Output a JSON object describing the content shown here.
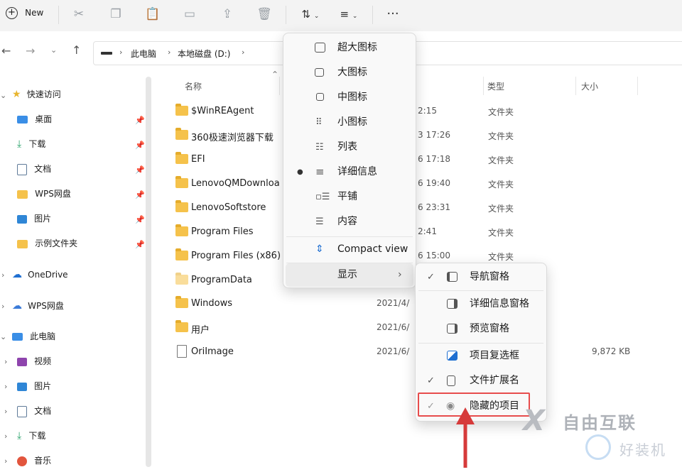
{
  "toolbar": {
    "new_label": "New",
    "icons": [
      "cut-icon",
      "copy-icon",
      "paste-icon",
      "rename-icon",
      "share-icon",
      "delete-icon",
      "sort-icon",
      "view-icon",
      "more-icon"
    ]
  },
  "address": {
    "crumbs": [
      "此电脑",
      "本地磁盘 (D:)"
    ]
  },
  "columns": {
    "name": "名称",
    "type": "类型",
    "size": "大小"
  },
  "sidebar": {
    "quick_access": "快速访问",
    "pinned": [
      "桌面",
      "下载",
      "文档",
      "WPS网盘",
      "图片",
      "示例文件夹"
    ],
    "onedrive": "OneDrive",
    "wps": "WPS网盘",
    "this_pc": "此电脑",
    "pc_items": [
      "视频",
      "图片",
      "文档",
      "下载",
      "音乐"
    ]
  },
  "files": [
    {
      "name": "$WinREAgent",
      "date": "2:15",
      "type": "文件夹",
      "size": ""
    },
    {
      "name": "360极速浏览器下载",
      "date": "3 17:26",
      "type": "文件夹",
      "size": ""
    },
    {
      "name": "EFI",
      "date": "6 17:18",
      "type": "文件夹",
      "size": ""
    },
    {
      "name": "LenovoQMDownloa",
      "date": "6 19:40",
      "type": "文件夹",
      "size": ""
    },
    {
      "name": "LenovoSoftstore",
      "date": "6 23:31",
      "type": "文件夹",
      "size": ""
    },
    {
      "name": "Program Files",
      "date": "2:41",
      "type": "文件夹",
      "size": ""
    },
    {
      "name": "Program Files (x86)",
      "date": "6 15:00",
      "type": "文件夹",
      "size": ""
    },
    {
      "name": "ProgramData",
      "date": "",
      "type": "",
      "size": ""
    },
    {
      "name": "Windows",
      "date": "2021/4/",
      "type": "",
      "size": ""
    },
    {
      "name": "用户",
      "date": "2021/6/",
      "type": "",
      "size": ""
    },
    {
      "name": "OriImage",
      "date": "2021/6/",
      "type": "",
      "size": "9,872 KB"
    }
  ],
  "view_menu": {
    "items": [
      "超大图标",
      "大图标",
      "中图标",
      "小图标",
      "列表",
      "详细信息",
      "平铺",
      "内容"
    ],
    "selected": "详细信息",
    "compact": "Compact view",
    "show": "显示"
  },
  "show_menu": {
    "nav_pane": "导航窗格",
    "details_pane": "详细信息窗格",
    "preview_pane": "预览窗格",
    "checkboxes": "项目复选框",
    "extensions": "文件扩展名",
    "hidden_items": "隐藏的项目"
  },
  "watermark": {
    "brand": "自由互联",
    "sub": "好装机"
  },
  "colors": {
    "highlight_border": "#e74c4c",
    "arrow": "#d63a3a",
    "folder": "#f5c24b"
  }
}
